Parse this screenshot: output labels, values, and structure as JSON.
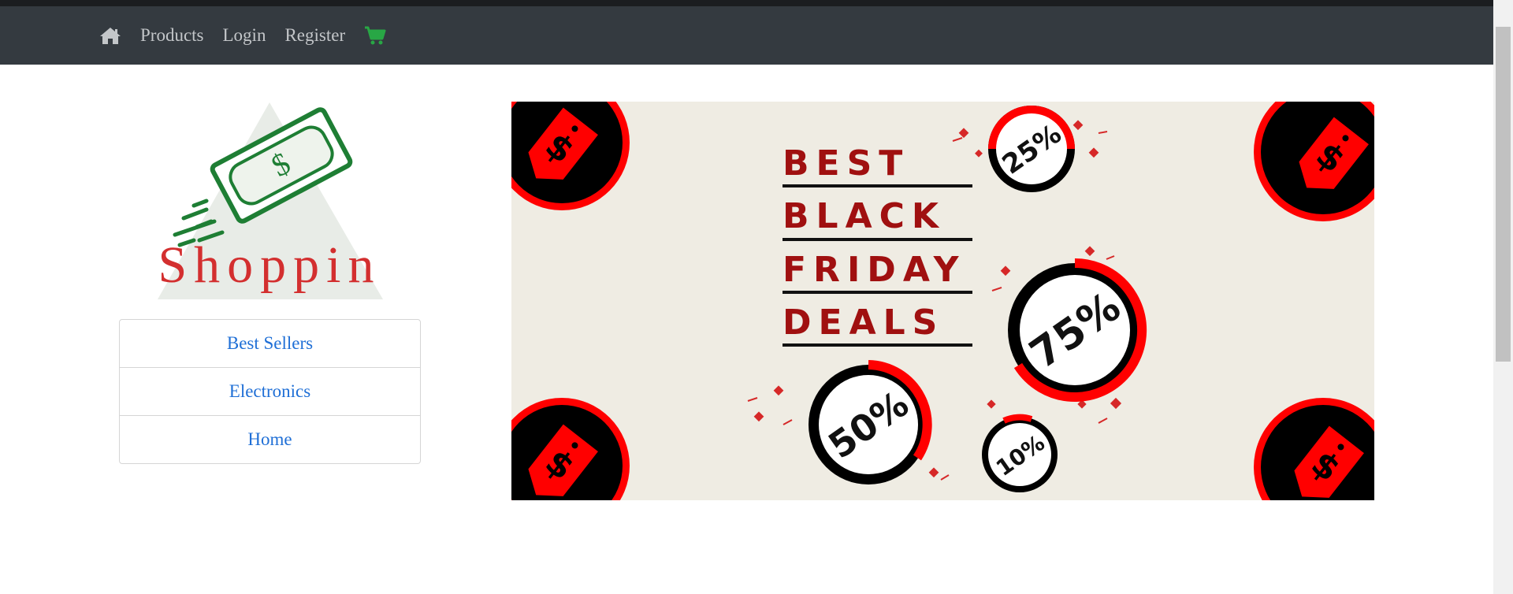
{
  "nav": {
    "home_icon": "home-icon",
    "links": [
      "Products",
      "Login",
      "Register"
    ],
    "cart_icon": "shopping-cart-icon",
    "bg_color": "#343a40",
    "cart_color": "#28a745"
  },
  "logo": {
    "text": "Shoppin",
    "money_symbol": "$",
    "text_color": "#d32f2f",
    "money_color": "#1e7e34"
  },
  "categories": [
    "Best Sellers",
    "Electronics",
    "Home"
  ],
  "banner": {
    "headline_lines": [
      "BEST",
      "BLACK",
      "FRIDAY",
      "DEALS"
    ],
    "discounts": [
      "25%",
      "75%",
      "50%",
      "10%"
    ],
    "tag_symbol": "$",
    "bg_color": "#efece3",
    "accent_color": "#ff0000"
  }
}
